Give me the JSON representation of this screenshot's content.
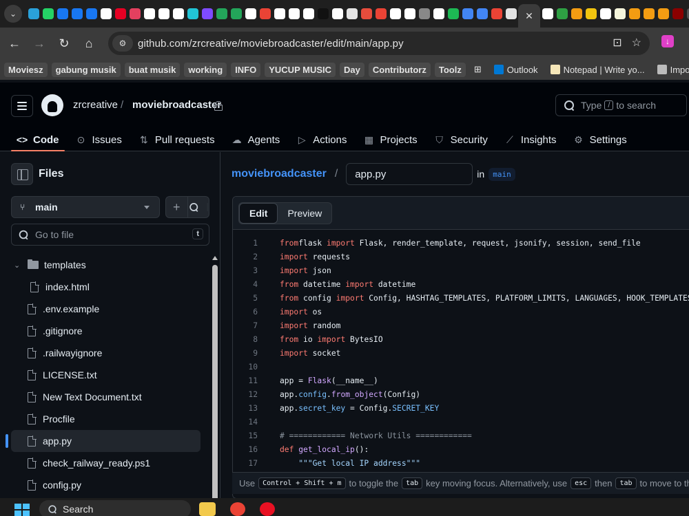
{
  "browser": {
    "favicon_colors": [
      "#2aa1da",
      "#25d366",
      "#1877f2",
      "#1877f2",
      "#1877f2",
      "#ffffff",
      "#e60023",
      "#e4405f",
      "#ffffff",
      "#ffffff",
      "#ffffff",
      "#21c4d6",
      "#7e4bff",
      "#23a55a",
      "#23a55a",
      "#ffffff",
      "#ea4335",
      "#ffffff",
      "#ffffff",
      "#ffffff",
      "#111111",
      "#ffffff",
      "#e3e3e3",
      "#e74c3c",
      "#ea4335",
      "#ffffff",
      "#ffffff",
      "#888888",
      "#ffffff",
      "#1db954",
      "#4285f4",
      "#4285f4",
      "#ea4335",
      "#e3e3e3"
    ],
    "favicons_right": [
      "#ffffff",
      "#2ea043",
      "#f39c12",
      "#f1c40f",
      "#ffffff",
      "#f5f5dc",
      "#f39c12",
      "#f39c12",
      "#f39c12",
      "#8b0000",
      "#555555",
      "#555555",
      "#555555"
    ],
    "active_tab_close": "✕",
    "url": "github.com/zrcreative/moviebroadcaster/edit/main/app.py",
    "bookmarks": [
      "Moviesz",
      "gabung musik",
      "buat musik",
      "working",
      "INFO",
      "YUCUP MUSIC",
      "Day",
      "Contributorz",
      "Toolz"
    ],
    "bookmarks_plain": [
      {
        "label": "Outlook",
        "icon_color": "#0078d4"
      },
      {
        "label": "Notepad | Write yo...",
        "icon_color": "#f5e6b8"
      },
      {
        "label": "Importe",
        "icon_color": "#bbbbbb"
      }
    ]
  },
  "github": {
    "owner": "zrcreative",
    "separator": "/",
    "repo": "moviebroadcaster",
    "search_placeholder_before": "Type",
    "search_key": "/",
    "search_placeholder_after": "to search",
    "nav": [
      {
        "label": "Code",
        "icon": "<>"
      },
      {
        "label": "Issues",
        "icon": "⊙"
      },
      {
        "label": "Pull requests",
        "icon": "⇅"
      },
      {
        "label": "Agents",
        "icon": "☁"
      },
      {
        "label": "Actions",
        "icon": "▷"
      },
      {
        "label": "Projects",
        "icon": "▦"
      },
      {
        "label": "Security",
        "icon": "⛉"
      },
      {
        "label": "Insights",
        "icon": "⟋"
      },
      {
        "label": "Settings",
        "icon": "⚙"
      }
    ]
  },
  "sidebar": {
    "title": "Files",
    "branch": "main",
    "plus": "+",
    "search_btn": "⌕",
    "goto_placeholder": "Go to file",
    "goto_key": "t",
    "tree": [
      {
        "label": "templates",
        "type": "folder",
        "expanded": true,
        "indent": 0
      },
      {
        "label": "index.html",
        "type": "file",
        "indent": 1
      },
      {
        "label": ".env.example",
        "type": "file",
        "indent": 0
      },
      {
        "label": ".gitignore",
        "type": "file",
        "indent": 0
      },
      {
        "label": ".railwayignore",
        "type": "file",
        "indent": 0
      },
      {
        "label": "LICENSE.txt",
        "type": "file",
        "indent": 0
      },
      {
        "label": "New Text Document.txt",
        "type": "file",
        "indent": 0
      },
      {
        "label": "Procfile",
        "type": "file",
        "indent": 0
      },
      {
        "label": "app.py",
        "type": "file",
        "indent": 0,
        "selected": true
      },
      {
        "label": "check_railway_ready.ps1",
        "type": "file",
        "indent": 0
      },
      {
        "label": "config.py",
        "type": "file",
        "indent": 0
      }
    ]
  },
  "editor": {
    "crumb_repo": "moviebroadcaster",
    "crumb_sep": "/",
    "filename": "app.py",
    "in_label": "in",
    "branch": "main",
    "tab_edit": "Edit",
    "tab_preview": "Preview",
    "lines": [
      [
        [
          "kw",
          "from"
        ],
        [
          "",
          "flask "
        ],
        [
          "kw",
          "import"
        ],
        [
          "",
          " Flask, render_template, request, jsonify, session, send_file"
        ]
      ],
      [
        [
          "kw",
          "import"
        ],
        [
          "",
          " requests"
        ]
      ],
      [
        [
          "kw",
          "import"
        ],
        [
          "",
          " json"
        ]
      ],
      [
        [
          "kw",
          "from"
        ],
        [
          "",
          " datetime "
        ],
        [
          "kw",
          "import"
        ],
        [
          "",
          " datetime"
        ]
      ],
      [
        [
          "kw",
          "from"
        ],
        [
          "",
          " config "
        ],
        [
          "kw",
          "import"
        ],
        [
          "",
          " Config, HASHTAG_TEMPLATES, PLATFORM_LIMITS, LANGUAGES, HOOK_TEMPLATES, "
        ]
      ],
      [
        [
          "kw",
          "import"
        ],
        [
          "",
          " os"
        ]
      ],
      [
        [
          "kw",
          "import"
        ],
        [
          "",
          " random"
        ]
      ],
      [
        [
          "kw",
          "from"
        ],
        [
          "",
          " io "
        ],
        [
          "kw",
          "import"
        ],
        [
          "",
          " BytesIO"
        ]
      ],
      [
        [
          "kw",
          "import"
        ],
        [
          "",
          " socket"
        ]
      ],
      [],
      [
        [
          "",
          "app = "
        ],
        [
          "fn",
          "Flask"
        ],
        [
          "",
          "(__name__)"
        ]
      ],
      [
        [
          "",
          "app."
        ],
        [
          "attr",
          "config"
        ],
        [
          "",
          "."
        ],
        [
          "fn",
          "from_object"
        ],
        [
          "",
          "(Config)"
        ]
      ],
      [
        [
          "",
          "app."
        ],
        [
          "attr",
          "secret_key"
        ],
        [
          "",
          " = Config."
        ],
        [
          "attr",
          "SECRET_KEY"
        ]
      ],
      [],
      [
        [
          "cm",
          "# ============ Network Utils ============"
        ]
      ],
      [
        [
          "kw",
          "def"
        ],
        [
          "",
          " "
        ],
        [
          "fn",
          "get_local_ip"
        ],
        [
          "",
          "():"
        ]
      ],
      [
        [
          "",
          "    "
        ],
        [
          "str",
          "\"\"\"Get local IP address\"\"\""
        ]
      ]
    ],
    "footer": [
      {
        "t": "Use"
      },
      {
        "k": "Control + Shift + m"
      },
      {
        "t": "to toggle the"
      },
      {
        "k": "tab"
      },
      {
        "t": "key moving focus. Alternatively, use"
      },
      {
        "k": "esc"
      },
      {
        "t": "then"
      },
      {
        "k": "tab"
      },
      {
        "t": "to move to the"
      }
    ]
  },
  "taskbar": {
    "search_label": "Search",
    "icons": [
      {
        "name": "file-explorer-icon",
        "color": "#f2c94c"
      },
      {
        "name": "chrome-icon",
        "color": "#ea4335"
      },
      {
        "name": "record-icon",
        "color": "#e81123"
      }
    ]
  }
}
